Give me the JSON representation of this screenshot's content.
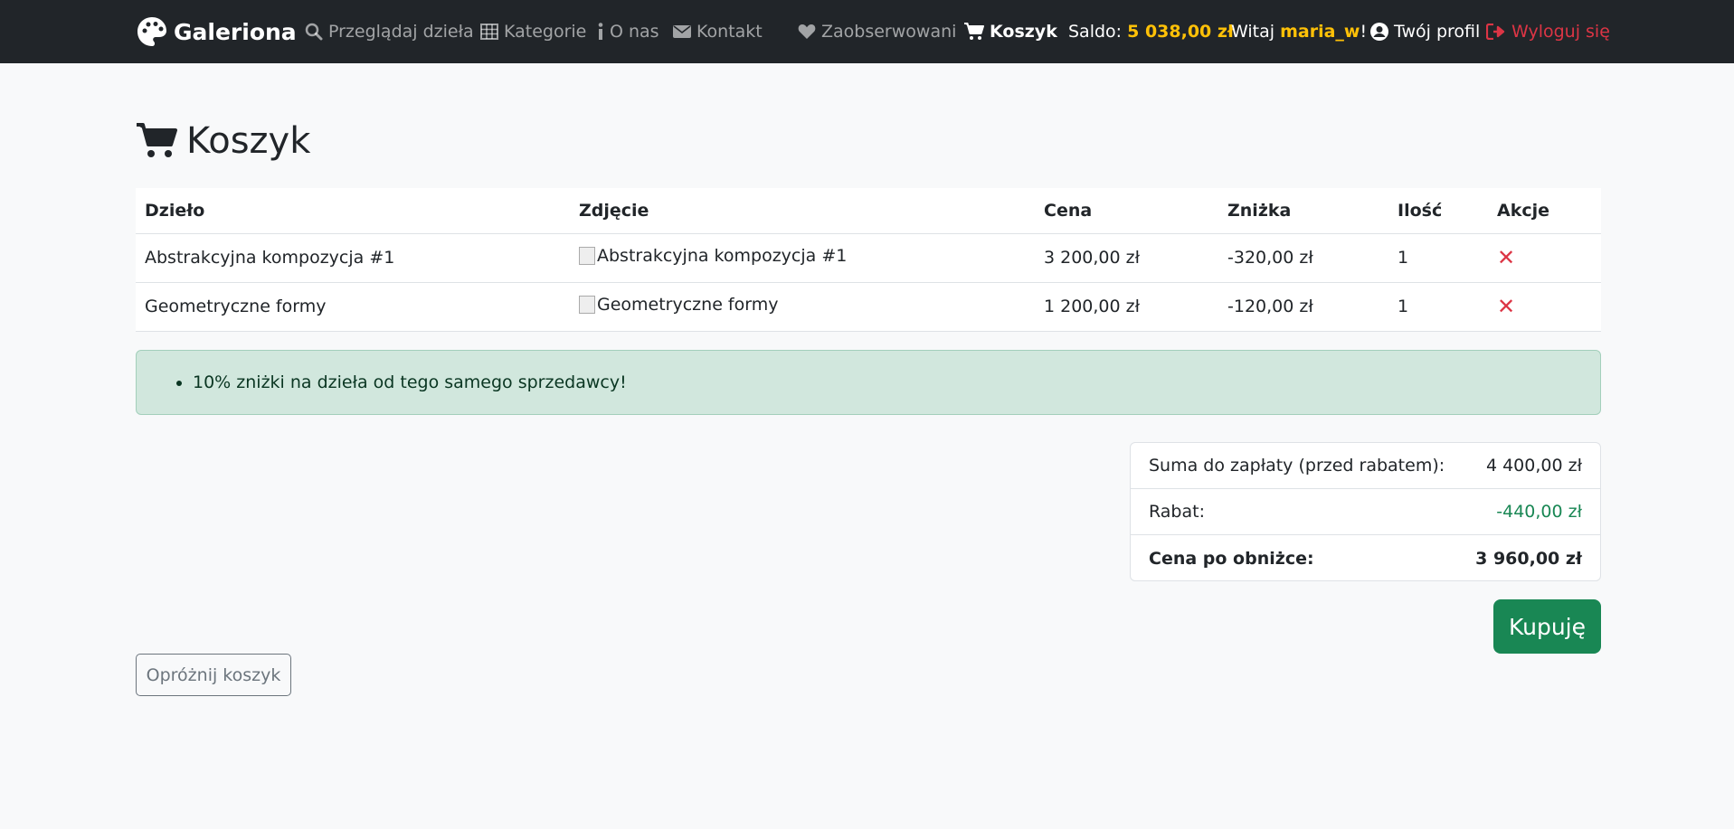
{
  "nav": {
    "brand": "Galeriona",
    "browse": "Przeglądaj dzieła",
    "categories": "Kategorie",
    "about": "O nas",
    "contact": "Kontakt",
    "watched": "Zaobserwowani",
    "cart": "Koszyk",
    "balance_label": "Saldo:",
    "balance_value": "5 038,00 zł",
    "greeting": "Witaj",
    "username": "maria_w",
    "exclaim": "!",
    "profile": "Twój profil",
    "logout": "Wyloguj się"
  },
  "page": {
    "title": "Koszyk"
  },
  "table": {
    "headers": [
      "Dzieło",
      "Zdjęcie",
      "Cena",
      "Zniżka",
      "Ilość",
      "Akcje"
    ],
    "rows": [
      {
        "name": "Abstrakcyjna kompozycja #1",
        "image_alt": "Abstrakcyjna kompozycja #1",
        "price": "3 200,00 zł",
        "discount": "-320,00 zł",
        "qty": "1",
        "action": "✕"
      },
      {
        "name": "Geometryczne formy",
        "image_alt": "Geometryczne formy",
        "price": "1 200,00 zł",
        "discount": "-120,00 zł",
        "qty": "1",
        "action": "✕"
      }
    ]
  },
  "promo": {
    "message": "10% zniżki na dzieła od tego samego sprzedawcy!"
  },
  "summary": {
    "subtotal_label": "Suma do zapłaty (przed rabatem):",
    "subtotal_value": "4 400,00 zł",
    "discount_label": "Rabat:",
    "discount_value": "-440,00 zł",
    "total_label": "Cena po obniżce:",
    "total_value": "3 960,00 zł"
  },
  "buttons": {
    "buy": "Kupuję",
    "empty": "Opróżnij koszyk"
  },
  "colors": {
    "navbar": "#212529",
    "accent_yellow": "#ffc107",
    "danger": "#dc3545",
    "success": "#198754",
    "alert_bg": "#d1e7dd"
  }
}
